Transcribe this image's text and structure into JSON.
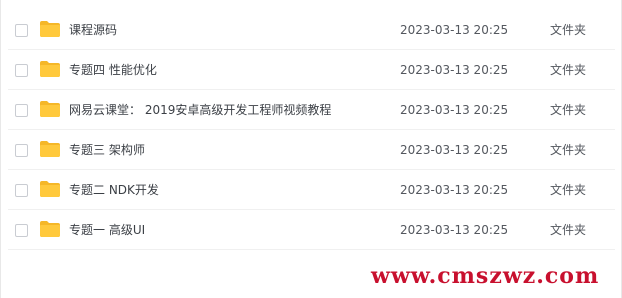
{
  "files": [
    {
      "name": "课程源码",
      "modified": "2023-03-13 20:25",
      "type": "文件夹",
      "icon": "folder-icon"
    },
    {
      "name": "专题四 性能优化",
      "modified": "2023-03-13 20:25",
      "type": "文件夹",
      "icon": "folder-icon"
    },
    {
      "name": "网易云课堂： 2019安卓高级开发工程师视频教程",
      "modified": "2023-03-13 20:25",
      "type": "文件夹",
      "icon": "folder-icon"
    },
    {
      "name": "专题三 架构师",
      "modified": "2023-03-13 20:25",
      "type": "文件夹",
      "icon": "folder-icon"
    },
    {
      "name": "专题二 NDK开发",
      "modified": "2023-03-13 20:25",
      "type": "文件夹",
      "icon": "folder-icon"
    },
    {
      "name": "专题一 高级UI",
      "modified": "2023-03-13 20:25",
      "type": "文件夹",
      "icon": "folder-icon"
    }
  ],
  "watermark": "www.cmszwz.com",
  "colors": {
    "folder": "#FFC93C",
    "folder_tab": "#F5B728",
    "watermark": "#C8102E"
  }
}
